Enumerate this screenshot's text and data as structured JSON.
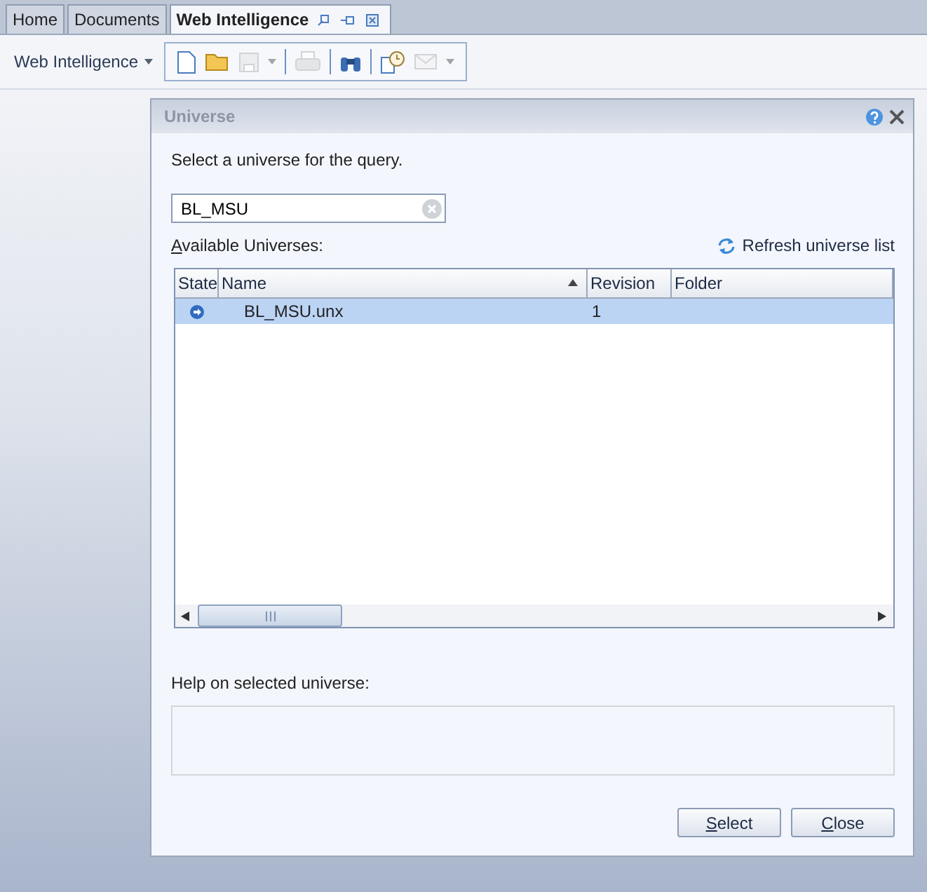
{
  "tabs": [
    {
      "label": "Home",
      "selected": false
    },
    {
      "label": "Documents",
      "selected": false
    },
    {
      "label": "Web Intelligence",
      "selected": true
    }
  ],
  "toolbar": {
    "menu": "Web Intelligence",
    "tools": [
      {
        "kind": "new",
        "disabled": false,
        "dropdown": false
      },
      {
        "kind": "open",
        "disabled": false,
        "dropdown": false
      },
      {
        "kind": "save",
        "disabled": true,
        "dropdown": true
      },
      {
        "kind": "sep"
      },
      {
        "kind": "print",
        "disabled": true,
        "dropdown": false
      },
      {
        "kind": "sep"
      },
      {
        "kind": "find",
        "disabled": false,
        "dropdown": false
      },
      {
        "kind": "sep"
      },
      {
        "kind": "schedule",
        "disabled": false,
        "dropdown": false
      },
      {
        "kind": "mail",
        "disabled": true,
        "dropdown": true
      }
    ]
  },
  "dialog": {
    "title": "Universe",
    "prompt": "Select a universe for the query.",
    "search": {
      "value": "BL_MSU"
    },
    "list_label": "Available Universes:",
    "refresh": "Refresh universe list",
    "columns": [
      {
        "label": "State",
        "sorted": false
      },
      {
        "label": "Name",
        "sorted": true
      },
      {
        "label": "Revision",
        "sorted": false
      },
      {
        "label": "Folder",
        "sorted": false
      }
    ],
    "rows": [
      {
        "name": "BL_MSU.unx",
        "revision": "1",
        "selected": true
      }
    ],
    "help_label": "Help on selected universe:",
    "buttons": [
      "Select",
      "Close"
    ]
  }
}
